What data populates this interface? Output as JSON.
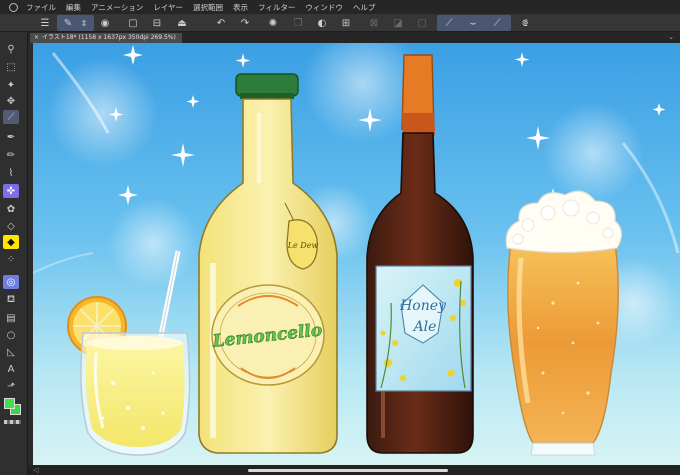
{
  "menubar": {
    "items": [
      "ファイル",
      "編集",
      "アニメーション",
      "レイヤー",
      "選択範囲",
      "表示",
      "フィルター",
      "ウィンドウ",
      "ヘルプ"
    ]
  },
  "document": {
    "tab_title": "イラスト18* (1158 x 1637px 350dpi 269.5%)"
  },
  "artwork": {
    "lemon_bottle_label": "Lemoncello",
    "lemon_tag_text": "Le Dew",
    "ale_label_line1": "Honey",
    "ale_label_line2": "Ale"
  },
  "colors": {
    "main": "#3fe04b",
    "sub": "#35d846",
    "accent": "#4f5b76",
    "sky_top": "#39a2e6",
    "sky_bottom": "#d5f3f6"
  },
  "icons": {
    "toolbar": [
      "menu-icon",
      "pen-tool-icon",
      "updown-icon",
      "record-icon",
      "new-file-icon",
      "open-folder-icon",
      "save-icon",
      "undo-icon",
      "redo-icon",
      "loading-icon",
      "copy-icon",
      "fill-icon",
      "transform-icon",
      "clear-icon",
      "gradient-icon",
      "frame-icon",
      "stabilizer-1-icon",
      "stabilizer-2-icon",
      "stabilizer-3-icon",
      "ruler-snap-icon"
    ],
    "tools": [
      "zoom-icon",
      "move-icon",
      "selection-icon",
      "auto-select-icon",
      "operation-icon",
      "pen-icon",
      "pencil-icon",
      "brush-icon",
      "airbrush-icon",
      "decoration-icon",
      "eraser-icon",
      "blend-icon",
      "fill-tool-icon",
      "gradient-tool-icon",
      "figure-icon",
      "frame-border-icon",
      "text-icon",
      "balloon-icon",
      "line-correction-icon",
      "eyedropper-icon"
    ]
  }
}
